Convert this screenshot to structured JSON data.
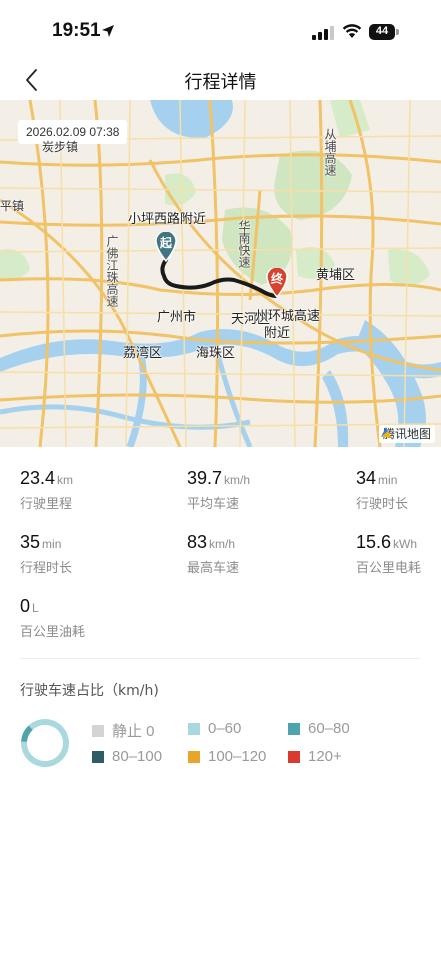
{
  "status_bar": {
    "time": "19:51",
    "battery": "44"
  },
  "nav": {
    "title": "行程详情"
  },
  "map": {
    "date": "2026.02.09 07:38",
    "start_pin": "起",
    "end_pin": "终",
    "attribution": "腾讯地图",
    "labels": {
      "tanbu": "炭步镇",
      "pingzhen": "平镇",
      "start_place": "小坪西路附近",
      "huanan": "华南快速",
      "foshan_expy": "广佛江珠高速",
      "conghua_expy": "从埔高速",
      "huangpu": "黄埔区",
      "guangzhou": "广州市",
      "tianhe": "天河区",
      "end_place_1": "州环城高速",
      "end_place_2": "附近",
      "liwan": "荔湾区",
      "haizhu": "海珠区"
    }
  },
  "stats": [
    {
      "value": "23.4",
      "unit": "km",
      "label": "行驶里程"
    },
    {
      "value": "39.7",
      "unit": "km/h",
      "label": "平均车速"
    },
    {
      "value": "34",
      "unit": "min",
      "label": "行驶时长"
    },
    {
      "value": "35",
      "unit": "min",
      "label": "行程时长"
    },
    {
      "value": "83",
      "unit": "km/h",
      "label": "最高车速"
    },
    {
      "value": "15.6",
      "unit": "kWh",
      "label": "百公里电耗"
    },
    {
      "value": "0",
      "unit": "L",
      "label": "百公里油耗"
    }
  ],
  "speed_section": {
    "title": "行驶车速占比（km/h)",
    "legend": [
      {
        "label": "静止 0",
        "color": "#d4d4d4"
      },
      {
        "label": "0–60",
        "color": "#a9d8df"
      },
      {
        "label": "60–80",
        "color": "#4fa3ad"
      },
      {
        "label": "80–100",
        "color": "#2f5d66"
      },
      {
        "label": "100–120",
        "color": "#e7a52c"
      },
      {
        "label": "120+",
        "color": "#d93a2f"
      }
    ],
    "shares": [
      {
        "range": "0–60",
        "fraction": 0.88
      },
      {
        "range": "60–80",
        "fraction": 0.12
      }
    ]
  }
}
